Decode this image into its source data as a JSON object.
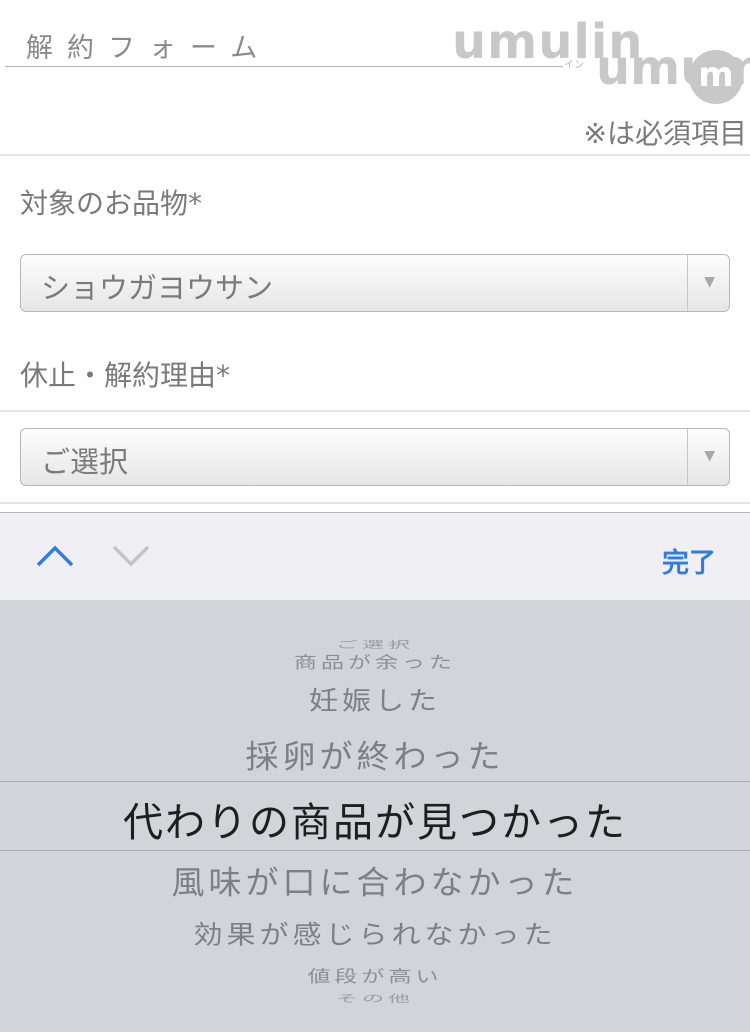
{
  "header": {
    "form_title": "解約フォーム",
    "logo_umulin": "umulin",
    "logo_umulin_sub": "イン",
    "logo_umum": "umum",
    "logo_circle": "m",
    "required_note": "※は必須項目"
  },
  "fields": {
    "product": {
      "label": "対象のお品物*",
      "value": "ショウガヨウサン"
    },
    "reason": {
      "label": "休止・解約理由*",
      "value": "ご選択"
    }
  },
  "toolbar": {
    "done_label": "完了",
    "up_icon": "chevron-up-icon",
    "down_icon": "chevron-down-icon",
    "colors": {
      "accent": "#2f7de1"
    }
  },
  "picker": {
    "options": [
      "ご選択",
      "商品が余った",
      "妊娠した",
      "採卵が終わった",
      "代わりの商品が見つかった",
      "風味が口に合わなかった",
      "効果が感じられなかった",
      "値段が高い",
      "その他"
    ],
    "selected": "代わりの商品が見つかった"
  }
}
